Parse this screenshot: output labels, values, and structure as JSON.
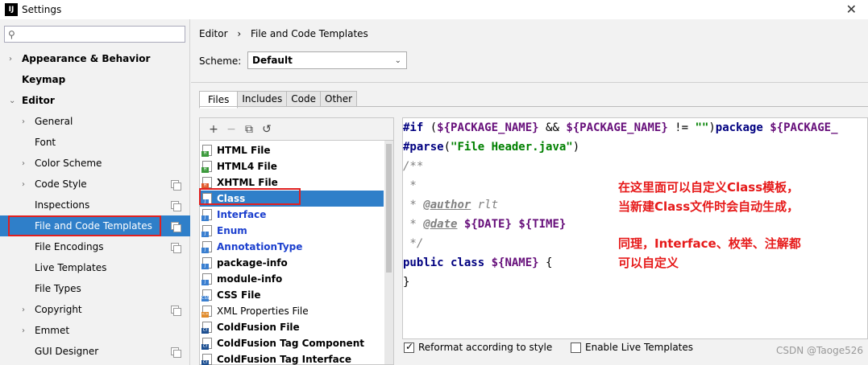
{
  "window": {
    "title": "Settings",
    "app_icon_text": "IJ",
    "close_glyph": "✕"
  },
  "search": {
    "placeholder": "",
    "icon": "search-icon"
  },
  "sidebar": {
    "items": [
      {
        "label": "Appearance & Behavior",
        "arrow": "›",
        "bold": true
      },
      {
        "label": "Keymap",
        "arrow": "",
        "bold": true
      },
      {
        "label": "Editor",
        "arrow": "⌄",
        "bold": true
      },
      {
        "label": "General",
        "arrow": "›"
      },
      {
        "label": "Font",
        "arrow": ""
      },
      {
        "label": "Color Scheme",
        "arrow": "›"
      },
      {
        "label": "Code Style",
        "arrow": "›",
        "copy": true
      },
      {
        "label": "Inspections",
        "arrow": "",
        "copy": true
      },
      {
        "label": "File and Code Templates",
        "arrow": "",
        "copy": true,
        "selected": true
      },
      {
        "label": "File Encodings",
        "arrow": "",
        "copy": true
      },
      {
        "label": "Live Templates",
        "arrow": ""
      },
      {
        "label": "File Types",
        "arrow": ""
      },
      {
        "label": "Copyright",
        "arrow": "›",
        "copy": true
      },
      {
        "label": "Emmet",
        "arrow": "›"
      },
      {
        "label": "GUI Designer",
        "arrow": "",
        "copy": true
      }
    ]
  },
  "breadcrumb": {
    "parent": "Editor",
    "separator": "›",
    "current": "File and Code Templates"
  },
  "scheme": {
    "label": "Scheme:",
    "value": "Default",
    "chevron": "⌄"
  },
  "tabs": [
    "Files",
    "Includes",
    "Code",
    "Other"
  ],
  "toolbar": {
    "add": "+",
    "remove": "−",
    "copy": "⧉",
    "reset": "↺"
  },
  "files": [
    {
      "label": "HTML File",
      "tag": "H",
      "tagColor": "#3c9a3c"
    },
    {
      "label": "HTML4 File",
      "tag": "H",
      "tagColor": "#3c9a3c"
    },
    {
      "label": "XHTML File",
      "tag": "H",
      "tagColor": "#e0582a"
    },
    {
      "label": "Class",
      "tag": "J",
      "tagColor": "#3a7fd0",
      "selected": true
    },
    {
      "label": "Interface",
      "tag": "J",
      "tagColor": "#3a7fd0",
      "blue": true
    },
    {
      "label": "Enum",
      "tag": "J",
      "tagColor": "#3a7fd0",
      "blue": true
    },
    {
      "label": "AnnotationType",
      "tag": "J",
      "tagColor": "#3a7fd0",
      "blue": true
    },
    {
      "label": "package-info",
      "tag": "J",
      "tagColor": "#3a7fd0"
    },
    {
      "label": "module-info",
      "tag": "J",
      "tagColor": "#3a7fd0"
    },
    {
      "label": "CSS File",
      "tag": "CSS",
      "tagColor": "#3a7fd0"
    },
    {
      "label": "XML Properties File",
      "tag": "<>",
      "tagColor": "#e08a2a",
      "normal": true
    },
    {
      "label": "ColdFusion File",
      "tag": "Cf",
      "tagColor": "#1d4f91"
    },
    {
      "label": "ColdFusion Tag Component",
      "tag": "Cf",
      "tagColor": "#1d4f91"
    },
    {
      "label": "ColdFusion Tag Interface",
      "tag": "Cf",
      "tagColor": "#1d4f91"
    }
  ],
  "code": {
    "l1_if": "#if",
    "l1_open": " (",
    "l1_var1": "${PACKAGE_NAME}",
    "l1_and": " && ",
    "l1_var2": "${PACKAGE_NAME}",
    "l1_neq": " != ",
    "l1_str": "\"\"",
    "l1_close": ")",
    "l1_pkg": "package",
    "l1_sp": " ",
    "l1_var3": "${PACKAGE_",
    "l2_parse": "#parse",
    "l2_open": "(",
    "l2_str": "\"File Header.java\"",
    "l2_close": ")",
    "l3": "/**",
    "l4": " *",
    "l5_pre": " * ",
    "l5_tag": "@author",
    "l5_val": " rlt",
    "l6_pre": " * ",
    "l6_tag": "@date",
    "l6_sp": " ",
    "l6_var1": "${DATE}",
    "l6_sp2": " ",
    "l6_var2": "${TIME}",
    "l7": " */",
    "l8_kw": "public class",
    "l8_sp": " ",
    "l8_var": "${NAME}",
    "l8_brace": " {",
    "l9": "}"
  },
  "annotations": [
    "在这里面可以自定义Class模板，",
    "当新建Class文件时会自动生成，",
    "同理，Interface、枚举、注解都",
    "可以自定义"
  ],
  "options": {
    "reformat": {
      "label": "Reformat according to style",
      "checked": true
    },
    "live_templates": {
      "label": "Enable Live Templates",
      "checked": false
    }
  },
  "watermark": "CSDN @Taoge526"
}
